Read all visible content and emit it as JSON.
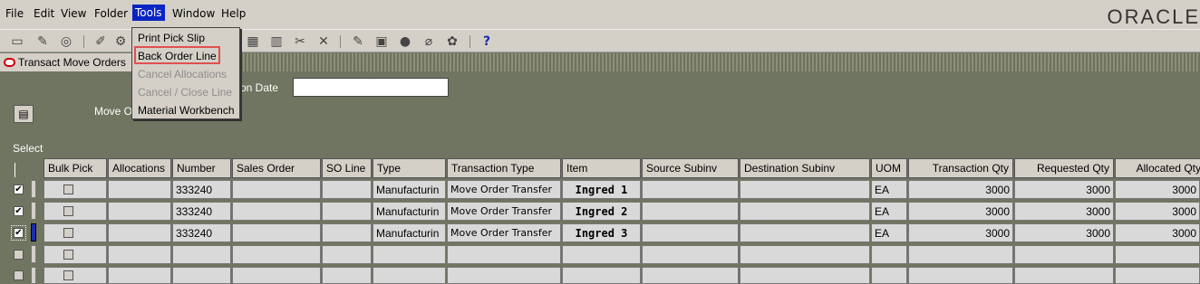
{
  "menubar": {
    "items": [
      "File",
      "Edit",
      "View",
      "Folder",
      "Tools",
      "Window",
      "Help"
    ],
    "logo": "ORACLE"
  },
  "window": {
    "title": "Transact Move Orders"
  },
  "form": {
    "date_label_partial": "on Date",
    "move_label_partial": "Move O",
    "select_label": "Select"
  },
  "tools_menu": {
    "items": [
      "Print Pick Slip",
      "Back Order Line",
      "Cancel Allocations",
      "Cancel / Close Line",
      "Material Workbench"
    ]
  },
  "table": {
    "headers": [
      "Bulk Pick",
      "Allocations",
      "Number",
      "Sales Order",
      "SO Line",
      "Type",
      "Transaction Type",
      "Item",
      "Source Subinv",
      "Destination Subinv",
      "UOM",
      "Transaction Qty",
      "Requested Qty",
      "Allocated Qty"
    ],
    "rows": [
      {
        "number": "333240",
        "type": "Manufacturin",
        "txn_type": "Move Order Transfer",
        "item": "Ingred 1",
        "uom": "EA",
        "txn_qty": "3000",
        "req_qty": "3000",
        "alloc_qty": "3000"
      },
      {
        "number": "333240",
        "type": "Manufacturin",
        "txn_type": "Move Order Transfer",
        "item": "Ingred 2",
        "uom": "EA",
        "txn_qty": "3000",
        "req_qty": "3000",
        "alloc_qty": "3000"
      },
      {
        "number": "333240",
        "type": "Manufacturin",
        "txn_type": "Move Order Transfer",
        "item": "Ingred 3",
        "uom": "EA",
        "txn_qty": "3000",
        "req_qty": "3000",
        "alloc_qty": "3000"
      }
    ]
  },
  "colors": {
    "menu_active": "#0a24c4",
    "highlight_box": "#e05050",
    "form_bg": "#6f7560"
  }
}
